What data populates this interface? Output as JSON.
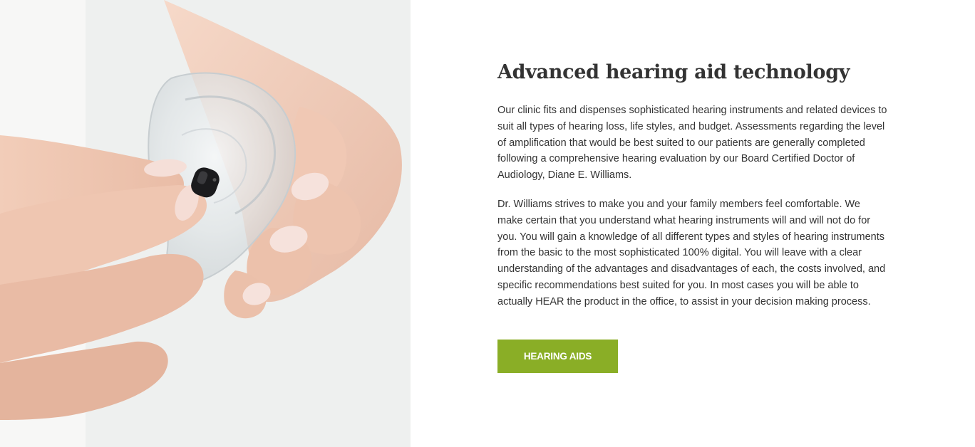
{
  "hero": {
    "image_alt": "Hands placing a small black hearing aid into a clear ear model"
  },
  "content": {
    "title": "Advanced hearing aid technology",
    "paragraph1": "Our clinic fits and dispenses sophisticated hearing instruments and related devices to suit all types of hearing loss, life styles, and budget. Assessments regarding the level of amplification that would be best suited to our patients are generally completed following a comprehensive hearing evaluation by our Board Certified Doctor of Audiology, Diane E. Williams.",
    "paragraph2": "Dr. Williams strives to make you and your family members feel comfortable. We make certain that you understand what hearing instruments will and will not do for you. You will gain a knowledge of all different types and styles of hearing instruments from the basic to the most sophisticated 100% digital. You will leave with a clear understanding of the advantages and disadvantages of each, the costs involved, and specific recommendations best suited for you. In most cases you will be able to actually HEAR the product in the office, to assist in your decision making process.",
    "button_label": "HEARING AIDS"
  },
  "colors": {
    "accent": "#8aae26",
    "text": "#333333",
    "background": "#ffffff"
  }
}
